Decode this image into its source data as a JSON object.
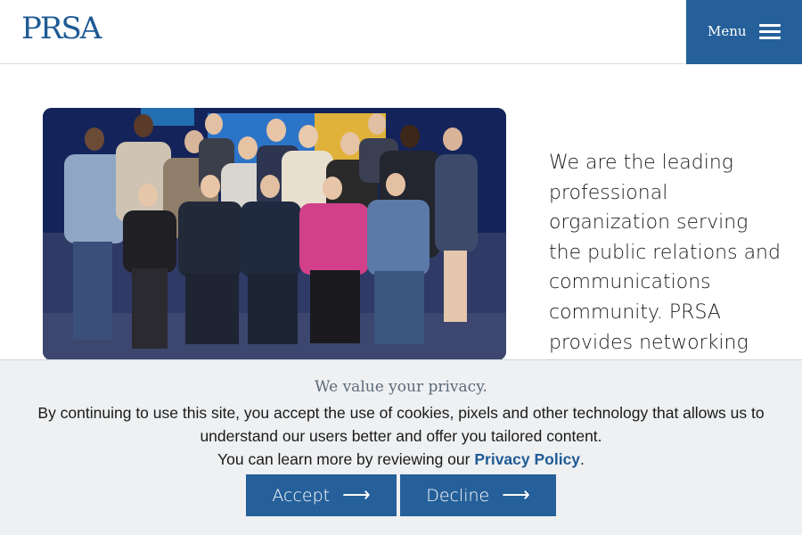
{
  "header": {
    "logo_text": "PRSA",
    "menu_label": "Menu",
    "brand_color": "#25609a"
  },
  "main": {
    "intro_text": "We are the leading professional organization serving the public relations and communications community. PRSA provides networking"
  },
  "cookie_banner": {
    "title": "We value your privacy.",
    "body_line1": "By continuing to use this site, you accept the use of cookies, pixels and other technology that allows us to understand our users better and offer you tailored content.",
    "body_line2_prefix": "You can learn more by reviewing our",
    "privacy_link": "Privacy Policy",
    "body_line2_suffix": ".",
    "accept_label": "Accept",
    "decline_label": "Decline",
    "arrow_glyph": "⟶"
  }
}
